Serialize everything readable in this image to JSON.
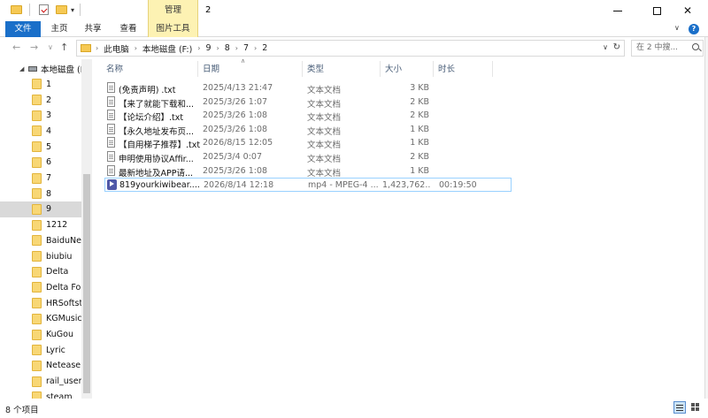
{
  "window": {
    "title": "2",
    "context_tab": "管理",
    "minimize_glyph": "",
    "maximize_glyph": "",
    "close_glyph": "✕"
  },
  "ribbon": {
    "tabs": [
      "文件",
      "主页",
      "共享",
      "查看",
      "图片工具"
    ],
    "collapse_glyph": "∨",
    "help_glyph": "?"
  },
  "address": {
    "breadcrumbs": [
      "此电脑",
      "本地磁盘 (F:)",
      "9",
      "8",
      "7",
      "2"
    ],
    "search_placeholder": "在 2 中搜..."
  },
  "sidebar": {
    "drive_label": "本地磁盘 (F",
    "items": [
      "1",
      "2",
      "3",
      "4",
      "5",
      "6",
      "7",
      "8",
      "9",
      "1212",
      "BaiduNet",
      "biubiu",
      "Delta",
      "Delta Fore",
      "HRSoftsto",
      "KGMusic",
      "KuGou",
      "Lyric",
      "Netease",
      "rail_user_d",
      "steam"
    ],
    "selected": "9"
  },
  "columns": {
    "name": "名称",
    "date": "日期",
    "type": "类型",
    "size": "大小",
    "duration": "时长"
  },
  "files": [
    {
      "name": "(免责声明) .txt",
      "date": "2025/4/13 21:47",
      "type": "文本文档",
      "size": "3 KB",
      "duration": "",
      "icon": "txt-file-icon"
    },
    {
      "name": "【来了就能下载和...",
      "date": "2025/3/26 1:07",
      "type": "文本文档",
      "size": "2 KB",
      "duration": "",
      "icon": "txt-file-icon"
    },
    {
      "name": "【论坛介绍】.txt",
      "date": "2025/3/26 1:08",
      "type": "文本文档",
      "size": "2 KB",
      "duration": "",
      "icon": "txt-file-icon"
    },
    {
      "name": "【永久地址发布页...",
      "date": "2025/3/26 1:08",
      "type": "文本文档",
      "size": "1 KB",
      "duration": "",
      "icon": "txt-file-icon"
    },
    {
      "name": "【自用梯子推荐】.txt",
      "date": "2026/8/15 12:05",
      "type": "文本文档",
      "size": "1 KB",
      "duration": "",
      "icon": "txt-file-icon"
    },
    {
      "name": "申明使用协议Affir...",
      "date": "2025/3/4 0:07",
      "type": "文本文档",
      "size": "2 KB",
      "duration": "",
      "icon": "txt-file-icon"
    },
    {
      "name": "最新地址及APP请...",
      "date": "2025/3/26 1:08",
      "type": "文本文档",
      "size": "1 KB",
      "duration": "",
      "icon": "txt-file-icon"
    },
    {
      "name": "819yourkiwibear....",
      "date": "2026/8/14 12:18",
      "type": "mp4 - MPEG-4 ...",
      "size": "1,423,762...",
      "duration": "00:19:50",
      "icon": "mp4-file-icon"
    }
  ],
  "status": {
    "item_count": "8 个项目"
  }
}
